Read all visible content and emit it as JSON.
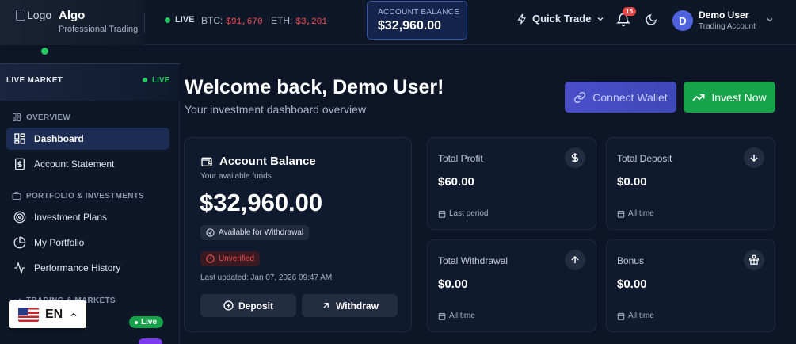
{
  "header": {
    "logo_alt": "Logo",
    "brand_name": "Algo",
    "brand_subtitle": "Professional Trading",
    "live_label": "LIVE",
    "tickers": [
      {
        "symbol": "BTC:",
        "price": "$91,670"
      },
      {
        "symbol": "ETH:",
        "price": "$3,201"
      }
    ],
    "balance_label": "ACCOUNT BALANCE",
    "balance_value": "$32,960.00",
    "quick_trade_label": "Quick Trade",
    "notification_count": "15",
    "user": {
      "initial": "D",
      "name": "Demo User",
      "role": "Trading Account"
    }
  },
  "sidebar": {
    "live_market_title": "LIVE MARKET",
    "live_market_status": "LIVE",
    "sections": [
      {
        "title": "OVERVIEW",
        "items": [
          {
            "label": "Dashboard",
            "icon": "grid-icon",
            "active": true
          },
          {
            "label": "Account Statement",
            "icon": "dollar-doc-icon",
            "active": false
          }
        ]
      },
      {
        "title": "PORTFOLIO & INVESTMENTS",
        "items": [
          {
            "label": "Investment Plans",
            "icon": "target-icon",
            "active": false
          },
          {
            "label": "My Portfolio",
            "icon": "pie-chart-icon",
            "active": false
          },
          {
            "label": "Performance History",
            "icon": "activity-icon",
            "active": false
          }
        ]
      },
      {
        "title": "TRADING & MARKETS",
        "items": []
      }
    ],
    "live_pill": "Live"
  },
  "language": {
    "code": "EN"
  },
  "main": {
    "welcome_title": "Welcome back, Demo User!",
    "welcome_subtitle": "Your investment dashboard overview",
    "connect_wallet_label": "Connect Wallet",
    "invest_now_label": "Invest Now",
    "balance_card": {
      "title": "Account Balance",
      "subtitle": "Your available funds",
      "amount": "$32,960.00",
      "available_badge": "Available for Withdrawal",
      "status_badge": "Unverified",
      "last_updated": "Last updated: Jan 07, 2026 09:47 AM",
      "deposit_label": "Deposit",
      "withdraw_label": "Withdraw"
    },
    "stats": [
      {
        "label": "Total Profit",
        "value": "$60.00",
        "footnote": "Last period",
        "icon": "dollar-icon"
      },
      {
        "label": "Total Deposit",
        "value": "$0.00",
        "footnote": "All time",
        "icon": "arrow-down-icon"
      },
      {
        "label": "Total Withdrawal",
        "value": "$0.00",
        "footnote": "All time",
        "icon": "arrow-up-icon"
      },
      {
        "label": "Bonus",
        "value": "$0.00",
        "footnote": "All time",
        "icon": "gift-icon"
      }
    ]
  },
  "colors": {
    "accent_green": "#22c55e",
    "price_red": "#f05252",
    "wallet_indigo": "#4a4fc9",
    "background": "#0d1526"
  }
}
